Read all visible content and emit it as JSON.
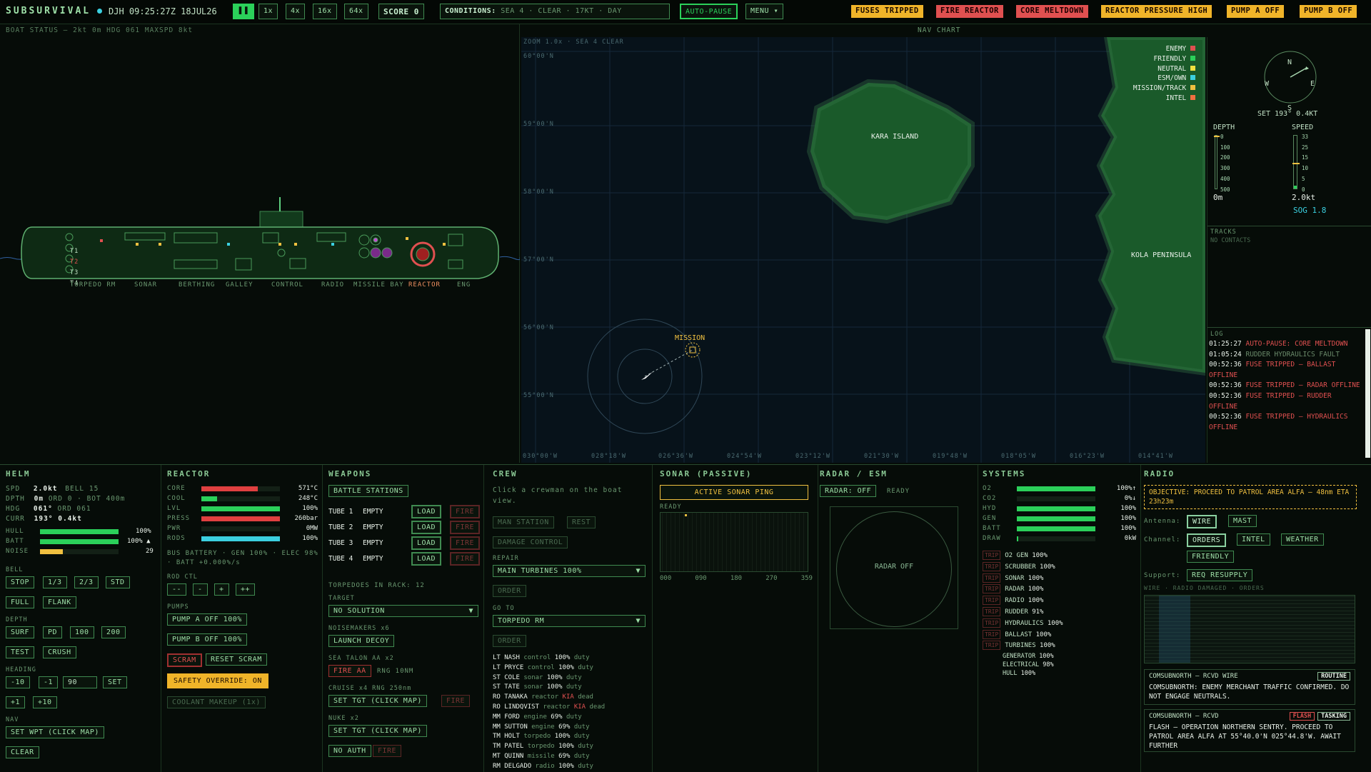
{
  "topbar": {
    "brand": "SUBSURVIVAL",
    "user_time": "DJH 09:25:27Z 18JUL26",
    "speeds": [
      "1x",
      "4x",
      "16x",
      "64x"
    ],
    "score": "SCORE  0",
    "conditions_label": "CONDITIONS:",
    "conditions": "SEA 4 · CLEAR · 17KT · DAY",
    "autopause": "AUTO-PAUSE",
    "menu": "MENU ▾",
    "alerts": [
      "FUSES TRIPPED",
      "FIRE REACTOR",
      "CORE MELTDOWN",
      "REACTOR PRESSURE HIGH",
      "PUMP A OFF",
      "PUMP B OFF"
    ]
  },
  "boat": {
    "status": "BOAT STATUS — 2kt 0m HDG 061 MAXSPD 8kt",
    "nav_chart_title": "NAV CHART",
    "compartments": [
      "TORPEDO RM",
      "SONAR",
      "BERTHING",
      "GALLEY",
      "CONTROL",
      "RADIO",
      "MISSILE BAY",
      "REACTOR",
      "ENG"
    ],
    "tubes": [
      "T1",
      "T2",
      "T3",
      "T4"
    ]
  },
  "chart": {
    "zoom": "ZOOM 1.0x · SEA 4 CLEAR",
    "lats": [
      "60°00'N",
      "59°00'N",
      "58°00'N",
      "57°00'N",
      "56°00'N",
      "55°00'N"
    ],
    "lons": [
      "030°00'W",
      "028°18'W",
      "026°36'W",
      "024°54'W",
      "023°12'W",
      "021°30'W",
      "019°48'W",
      "018°05'W",
      "016°23'W",
      "014°41'W"
    ],
    "island": "KARA ISLAND",
    "peninsula": "KOLA PENINSULA",
    "mission": "MISSION",
    "legend": [
      {
        "label": "ENEMY",
        "color": "#e05050"
      },
      {
        "label": "FRIENDLY",
        "color": "#2bd05a"
      },
      {
        "label": "NEUTRAL",
        "color": "#f0e040"
      },
      {
        "label": "ESM/OWN",
        "color": "#3bd0e0"
      },
      {
        "label": "MISSION/TRACK",
        "color": "#f0c040"
      },
      {
        "label": "INTEL",
        "color": "#f07040"
      }
    ]
  },
  "nav": {
    "compass": {
      "n": "N",
      "s": "S",
      "e": "E",
      "w": "W"
    },
    "set": "SET 193° 0.4KT",
    "depth_label": "DEPTH",
    "speed_label": "SPEED",
    "depth_ticks": [
      "0",
      "100",
      "200",
      "300",
      "400",
      "500"
    ],
    "speed_ticks": [
      "33",
      "25",
      "15",
      "10",
      "5",
      "0"
    ],
    "depth_val": "0m",
    "speed_val": "2.0kt",
    "sog": "SOG 1.8",
    "tracks_title": "TRACKS",
    "tracks": "NO CONTACTS"
  },
  "log": {
    "title": "LOG",
    "entries": [
      {
        "t": "01:25:27",
        "m": "AUTO-PAUSE: CORE MELTDOWN",
        "sev": "r"
      },
      {
        "t": "01:05:24",
        "m": "RUDDER HYDRAULICS FAULT",
        "sev": "d"
      },
      {
        "t": "00:52:36",
        "m": "FUSE TRIPPED — BALLAST OFFLINE",
        "sev": "r"
      },
      {
        "t": "00:52:36",
        "m": "FUSE TRIPPED — RADAR OFFLINE",
        "sev": "r"
      },
      {
        "t": "00:52:36",
        "m": "FUSE TRIPPED — RUDDER OFFLINE",
        "sev": "r"
      },
      {
        "t": "00:52:36",
        "m": "FUSE TRIPPED — HYDRAULICS OFFLINE",
        "sev": "r"
      }
    ]
  },
  "helm": {
    "title": "HELM",
    "spd_l": "SPD",
    "spd": "2.0kt",
    "bell": "BELL 15",
    "dpth_l": "DPTH",
    "dpth": "0m",
    "ord": "ORD 0 · BOT 400m",
    "hdg_l": "HDG",
    "hdg": "061°",
    "hdg_ord": "ORD 061",
    "curr_l": "CURR",
    "curr": "193° 0.4kt",
    "hull_l": "HULL",
    "hull": "100%",
    "hull_frac": 1.0,
    "batt_l": "BATT",
    "batt": "100% ▲",
    "batt_frac": 1.0,
    "noise_l": "NOISE",
    "noise": "29",
    "noise_frac": 0.29,
    "bell_l": "BELL",
    "bells": [
      "STOP",
      "1/3",
      "2/3",
      "STD",
      "FULL",
      "FLANK"
    ],
    "depth_l": "DEPTH",
    "depths": [
      "SURF",
      "PD",
      "100",
      "200",
      "TEST",
      "CRUSH"
    ],
    "heading_l": "HEADING",
    "heads": [
      "-10",
      "-1"
    ],
    "head_input": "90",
    "set": "SET",
    "heads2": [
      "+1",
      "+10"
    ],
    "nav_l": "NAV",
    "wpt": "SET WPT (CLICK MAP)",
    "clear": "CLEAR"
  },
  "reactor": {
    "title": "REACTOR",
    "rows": [
      {
        "l": "CORE",
        "v": "571°C",
        "f": 0.72,
        "c": "r"
      },
      {
        "l": "COOL",
        "v": "248°C",
        "f": 0.2,
        "c": "g"
      },
      {
        "l": "LVL",
        "v": "100%",
        "f": 1.0,
        "c": "g"
      },
      {
        "l": "PRESS",
        "v": "260bar",
        "f": 1.0,
        "c": "r"
      },
      {
        "l": "PWR",
        "v": "0MW",
        "f": 0.0,
        "c": "g"
      },
      {
        "l": "RODS",
        "v": "100%",
        "f": 1.0,
        "c": "c"
      }
    ],
    "bus": "BUS BATTERY · GEN 100% · ELEC 98% · BATT +0.000%/s",
    "rod_l": "ROD CTL",
    "rods": [
      "--",
      "-",
      "+",
      "++"
    ],
    "pumps_l": "PUMPS",
    "pump_a": "PUMP A OFF 100%",
    "pump_b": "PUMP B OFF 100%",
    "scram": "SCRAM",
    "reset": "RESET SCRAM",
    "override": "SAFETY OVERRIDE: ON",
    "coolant": "COOLANT MAKEUP (1x)"
  },
  "weapons": {
    "title": "WEAPONS",
    "battle": "BATTLE STATIONS",
    "tubes": [
      {
        "n": "TUBE 1",
        "s": "EMPTY"
      },
      {
        "n": "TUBE 2",
        "s": "EMPTY"
      },
      {
        "n": "TUBE 3",
        "s": "EMPTY"
      },
      {
        "n": "TUBE 4",
        "s": "EMPTY"
      }
    ],
    "load": "LOAD",
    "fire": "FIRE",
    "rack": "TORPEDOES IN RACK: 12",
    "target_l": "TARGET",
    "target": "NO SOLUTION",
    "noise_l": "NOISEMAKERS x6",
    "decoy": "LAUNCH DECOY",
    "sam_l": "SEA TALON AA x2",
    "fire_aa": "FIRE AA",
    "rng": "RNG 10NM",
    "cruise_l": "CRUISE x4 RNG 250nm",
    "set_tgt": "SET TGT (CLICK MAP)",
    "nuke_l": "NUKE x2",
    "noauth": "NO AUTH"
  },
  "crew": {
    "title": "CREW",
    "hint": "Click a crewman on the boat view.",
    "man": "MAN STATION",
    "rest": "REST",
    "dc": "DAMAGE CONTROL",
    "repair_l": "REPAIR",
    "repair": "MAIN TURBINES 100%",
    "order": "ORDER",
    "goto_l": "GO TO",
    "goto": "TORPEDO RM",
    "members": [
      {
        "r": "LT",
        "n": "NASH",
        "st": "control",
        "p": "100%",
        "s": "duty",
        "k": false
      },
      {
        "r": "LT",
        "n": "PRYCE",
        "st": "control",
        "p": "100%",
        "s": "duty",
        "k": false
      },
      {
        "r": "ST",
        "n": "COLE",
        "st": "sonar",
        "p": "100%",
        "s": "duty",
        "k": false
      },
      {
        "r": "ST",
        "n": "TATE",
        "st": "sonar",
        "p": "100%",
        "s": "duty",
        "k": false
      },
      {
        "r": "RO",
        "n": "TANAKA",
        "st": "reactor",
        "p": "KIA",
        "s": "dead",
        "k": true
      },
      {
        "r": "RO",
        "n": "LINDQVIST",
        "st": "reactor",
        "p": "KIA",
        "s": "dead",
        "k": true
      },
      {
        "r": "MM",
        "n": "FORD",
        "st": "engine",
        "p": "69%",
        "s": "duty",
        "k": false
      },
      {
        "r": "MM",
        "n": "SUTTON",
        "st": "engine",
        "p": "69%",
        "s": "duty",
        "k": false
      },
      {
        "r": "TM",
        "n": "HOLT",
        "st": "torpedo",
        "p": "100%",
        "s": "duty",
        "k": false
      },
      {
        "r": "TM",
        "n": "PATEL",
        "st": "torpedo",
        "p": "100%",
        "s": "duty",
        "k": false
      },
      {
        "r": "MT",
        "n": "QUINN",
        "st": "missile",
        "p": "69%",
        "s": "duty",
        "k": false
      },
      {
        "r": "RM",
        "n": "DELGADO",
        "st": "radio",
        "p": "100%",
        "s": "duty",
        "k": false
      }
    ]
  },
  "sonar": {
    "title": "SONAR (PASSIVE)",
    "ping": "ACTIVE SONAR PING",
    "ready": "READY",
    "ticks": [
      "000",
      "090",
      "180",
      "270",
      "359"
    ]
  },
  "radar": {
    "title": "RADAR / ESM",
    "btn": "RADAR: OFF",
    "ready": "READY",
    "off": "RADAR OFF"
  },
  "systems": {
    "title": "SYSTEMS",
    "bars": [
      {
        "l": "O2",
        "v": "100%↑",
        "f": 1.0
      },
      {
        "l": "CO2",
        "v": "0%↓",
        "f": 0.0
      },
      {
        "l": "HYD",
        "v": "100%",
        "f": 1.0
      },
      {
        "l": "GEN",
        "v": "100%",
        "f": 1.0
      },
      {
        "l": "BATT",
        "v": "100%",
        "f": 1.0
      },
      {
        "l": "DRAW",
        "v": "0kW",
        "f": 0.02
      }
    ],
    "trip": "TRIP",
    "subs": [
      {
        "n": "O2 GEN",
        "v": "100%"
      },
      {
        "n": "SCRUBBER",
        "v": "100%"
      },
      {
        "n": "SONAR",
        "v": "100%"
      },
      {
        "n": "RADAR",
        "v": "100%"
      },
      {
        "n": "RADIO",
        "v": "100%"
      },
      {
        "n": "RUDDER",
        "v": "91%"
      },
      {
        "n": "HYDRAULICS",
        "v": "100%"
      },
      {
        "n": "BALLAST",
        "v": "100%"
      },
      {
        "n": "TURBINES",
        "v": "100%"
      }
    ],
    "extra": [
      {
        "n": "GENERATOR",
        "v": "100%"
      },
      {
        "n": "ELECTRICAL",
        "v": "98%"
      },
      {
        "n": "HULL",
        "v": "100%"
      }
    ]
  },
  "radio": {
    "title": "RADIO",
    "objective": "OBJECTIVE: PROCEED TO PATROL AREA ALFA — 48nm ETA 23h23m",
    "antenna_l": "Antenna:",
    "wire": "WIRE",
    "mast": "MAST",
    "channel_l": "Channel:",
    "channels": [
      "ORDERS",
      "INTEL",
      "WEATHER",
      "FRIENDLY"
    ],
    "support_l": "Support:",
    "resupply": "REQ RESUPPLY",
    "status": "WIRE · RADIO DAMAGED · ORDERS",
    "msgs": [
      {
        "from": "COMSUBNORTH — RCVD WIRE",
        "tags": [
          "ROUTINE"
        ],
        "body": "COMSUBNORTH: ENEMY MERCHANT TRAFFIC CONFIRMED. DO NOT ENGAGE NEUTRALS."
      },
      {
        "from": "COMSUBNORTH — RCVD",
        "tags": [
          "FLASH",
          "TASKING"
        ],
        "body": "FLASH — OPERATION NORTHERN SENTRY. PROCEED TO PATROL AREA ALFA AT 55°40.0'N 025°44.8'W. AWAIT FURTHER"
      }
    ]
  }
}
